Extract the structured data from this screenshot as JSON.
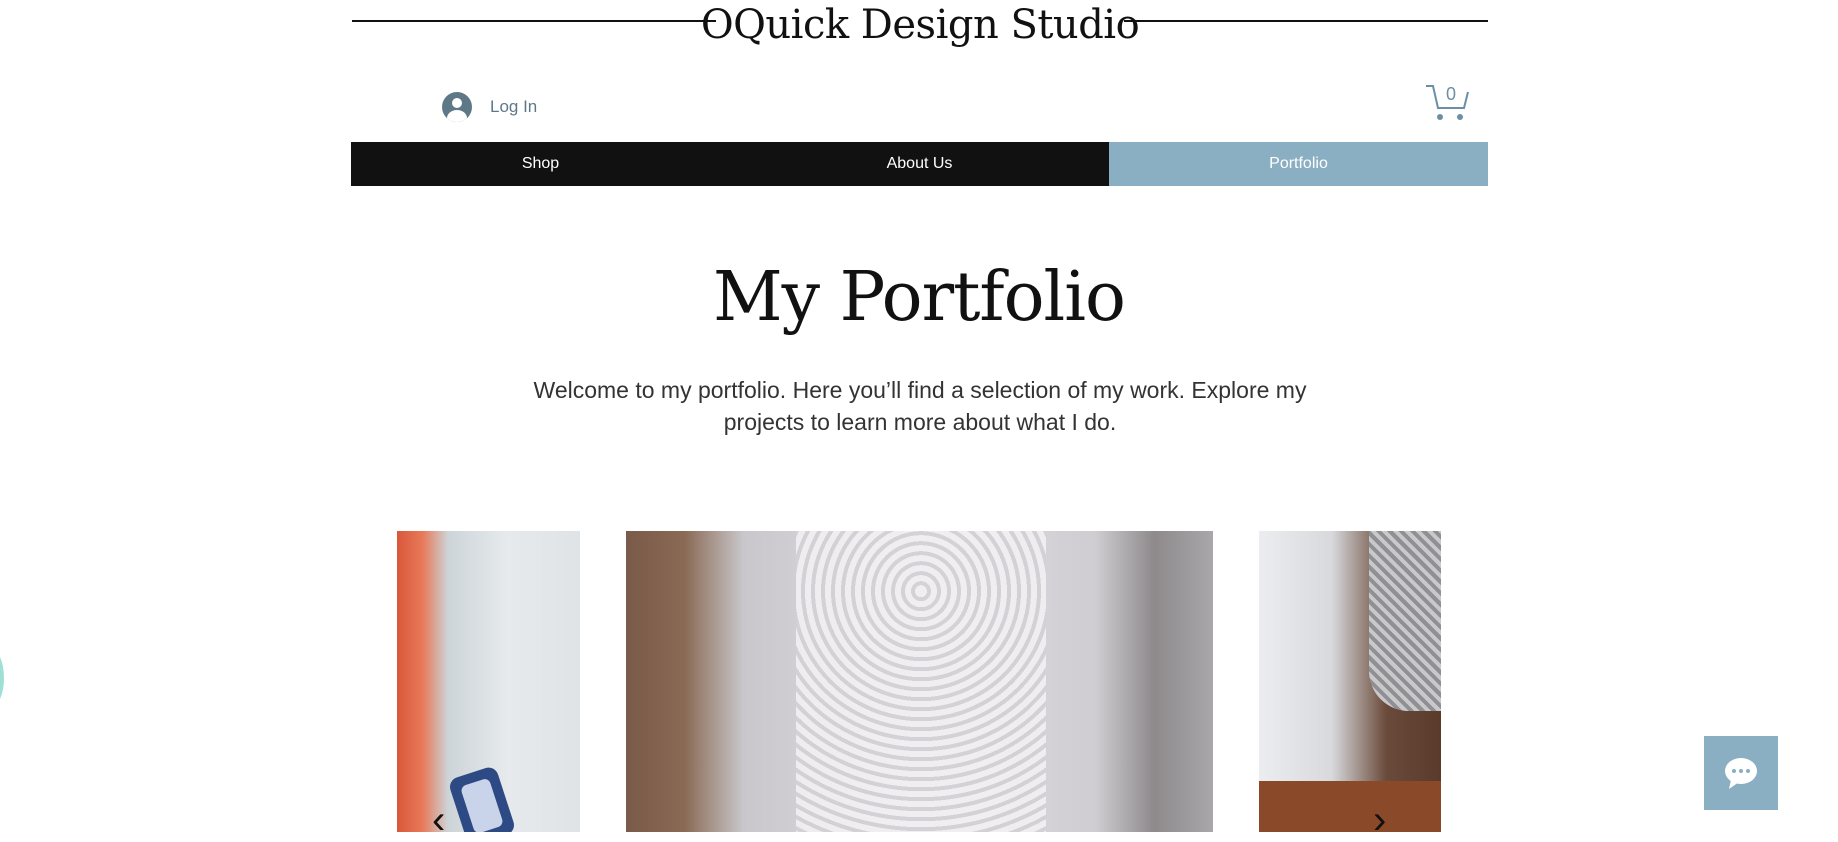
{
  "header": {
    "site_title": "OQuick Design Studio",
    "login_label": "Log In",
    "cart_count": "0"
  },
  "nav": {
    "items": [
      {
        "label": "Shop"
      },
      {
        "label": "About Us"
      },
      {
        "label": "Portfolio",
        "active": true
      }
    ]
  },
  "main": {
    "heading": "My Portfolio",
    "intro_line1": "Welcome to my portfolio. Here you’ll find a selection of my work. Explore my",
    "intro_line2": "projects to learn more about what I do."
  },
  "gallery": {
    "prev_arrow": "‹",
    "next_arrow": "›"
  },
  "colors": {
    "nav_bg": "#111111",
    "nav_active": "#8aafc3",
    "accent": "#6b8fa4"
  },
  "icons": [
    "avatar-icon",
    "cart-icon",
    "chat-icon"
  ]
}
